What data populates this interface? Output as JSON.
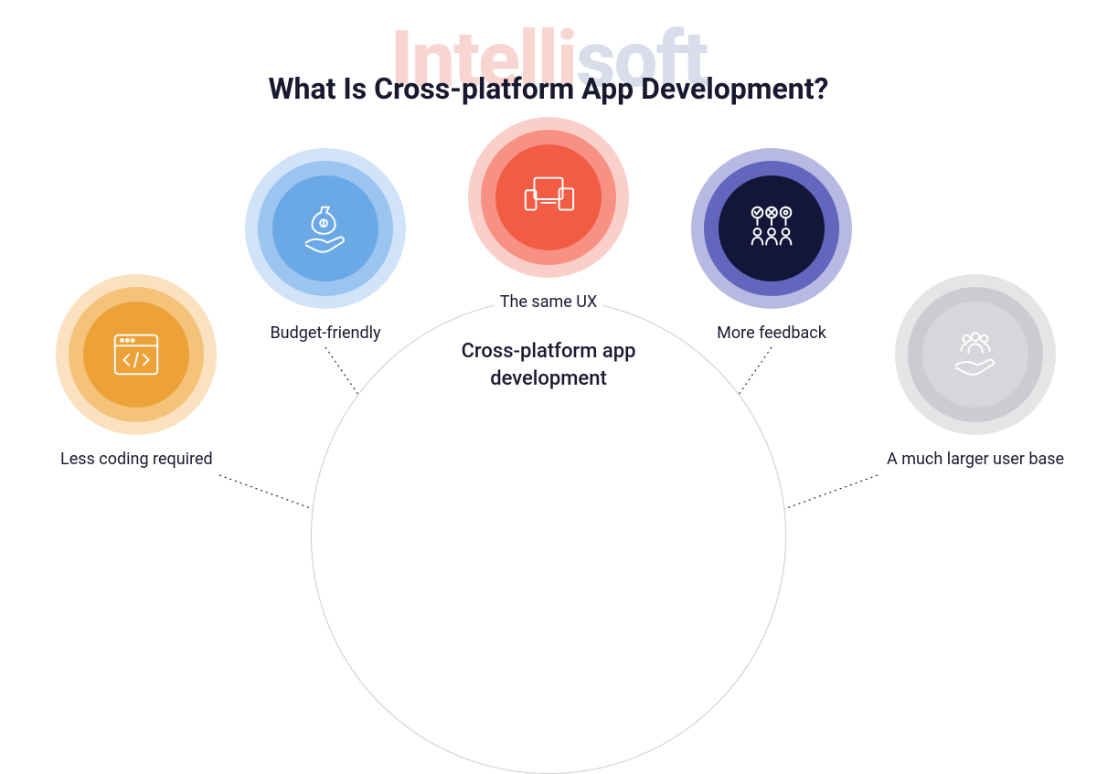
{
  "watermark": {
    "part1": "Intelli",
    "part2": "soft"
  },
  "title": "What Is Cross-platform App Development?",
  "hub_label": "Cross-platform app development",
  "nodes": [
    {
      "label": "Less coding required",
      "icon": "code-window-icon",
      "color": "#eda239"
    },
    {
      "label": "Budget-friendly",
      "icon": "money-hand-icon",
      "color": "#6aa9e6"
    },
    {
      "label": "The same UX",
      "icon": "devices-icon",
      "color": "#f25c45"
    },
    {
      "label": "More feedback",
      "icon": "feedback-icon",
      "color": "#131638"
    },
    {
      "label": "A much larger user base",
      "icon": "users-hand-icon",
      "color": "#d7d7db"
    }
  ]
}
